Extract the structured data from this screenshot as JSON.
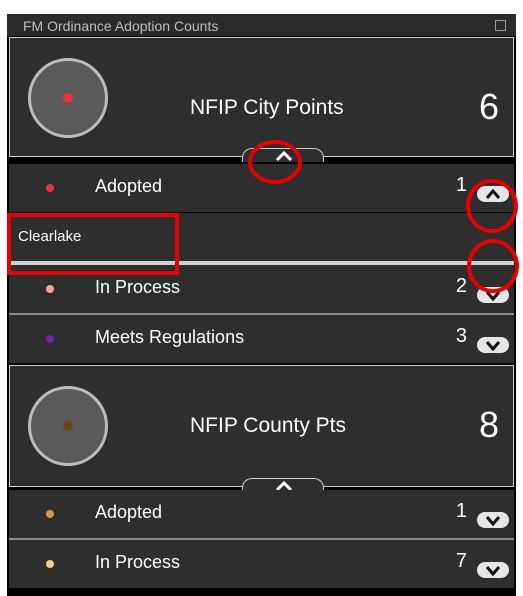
{
  "widget": {
    "title": "FM Ordinance Adoption Counts"
  },
  "groups": [
    {
      "title": "NFIP City Points",
      "count": "6",
      "dot_color": "#e8333c",
      "rows": [
        {
          "label": "Adopted",
          "count": "1",
          "dot_color": "#e8333c",
          "expanded": true
        },
        {
          "label": "In Process",
          "count": "2",
          "dot_color": "#f4a3a3",
          "expanded": false
        },
        {
          "label": "Meets Regulations",
          "count": "3",
          "dot_color": "#7a1fb0",
          "expanded": false
        }
      ],
      "detail": {
        "text": "Clearlake"
      }
    },
    {
      "title": "NFIP County Pts",
      "count": "8",
      "dot_color": "#6b4a12",
      "rows": [
        {
          "label": "Adopted",
          "count": "1",
          "dot_color": "#d9964a",
          "expanded": false
        },
        {
          "label": "In Process",
          "count": "7",
          "dot_color": "#f3cf8a",
          "expanded": false
        }
      ]
    }
  ],
  "icons": {
    "maximize": "maximize-icon",
    "chevron_up": "chevron-up-icon",
    "chevron_down": "chevron-down-icon"
  },
  "annotation_color": "#e60000"
}
